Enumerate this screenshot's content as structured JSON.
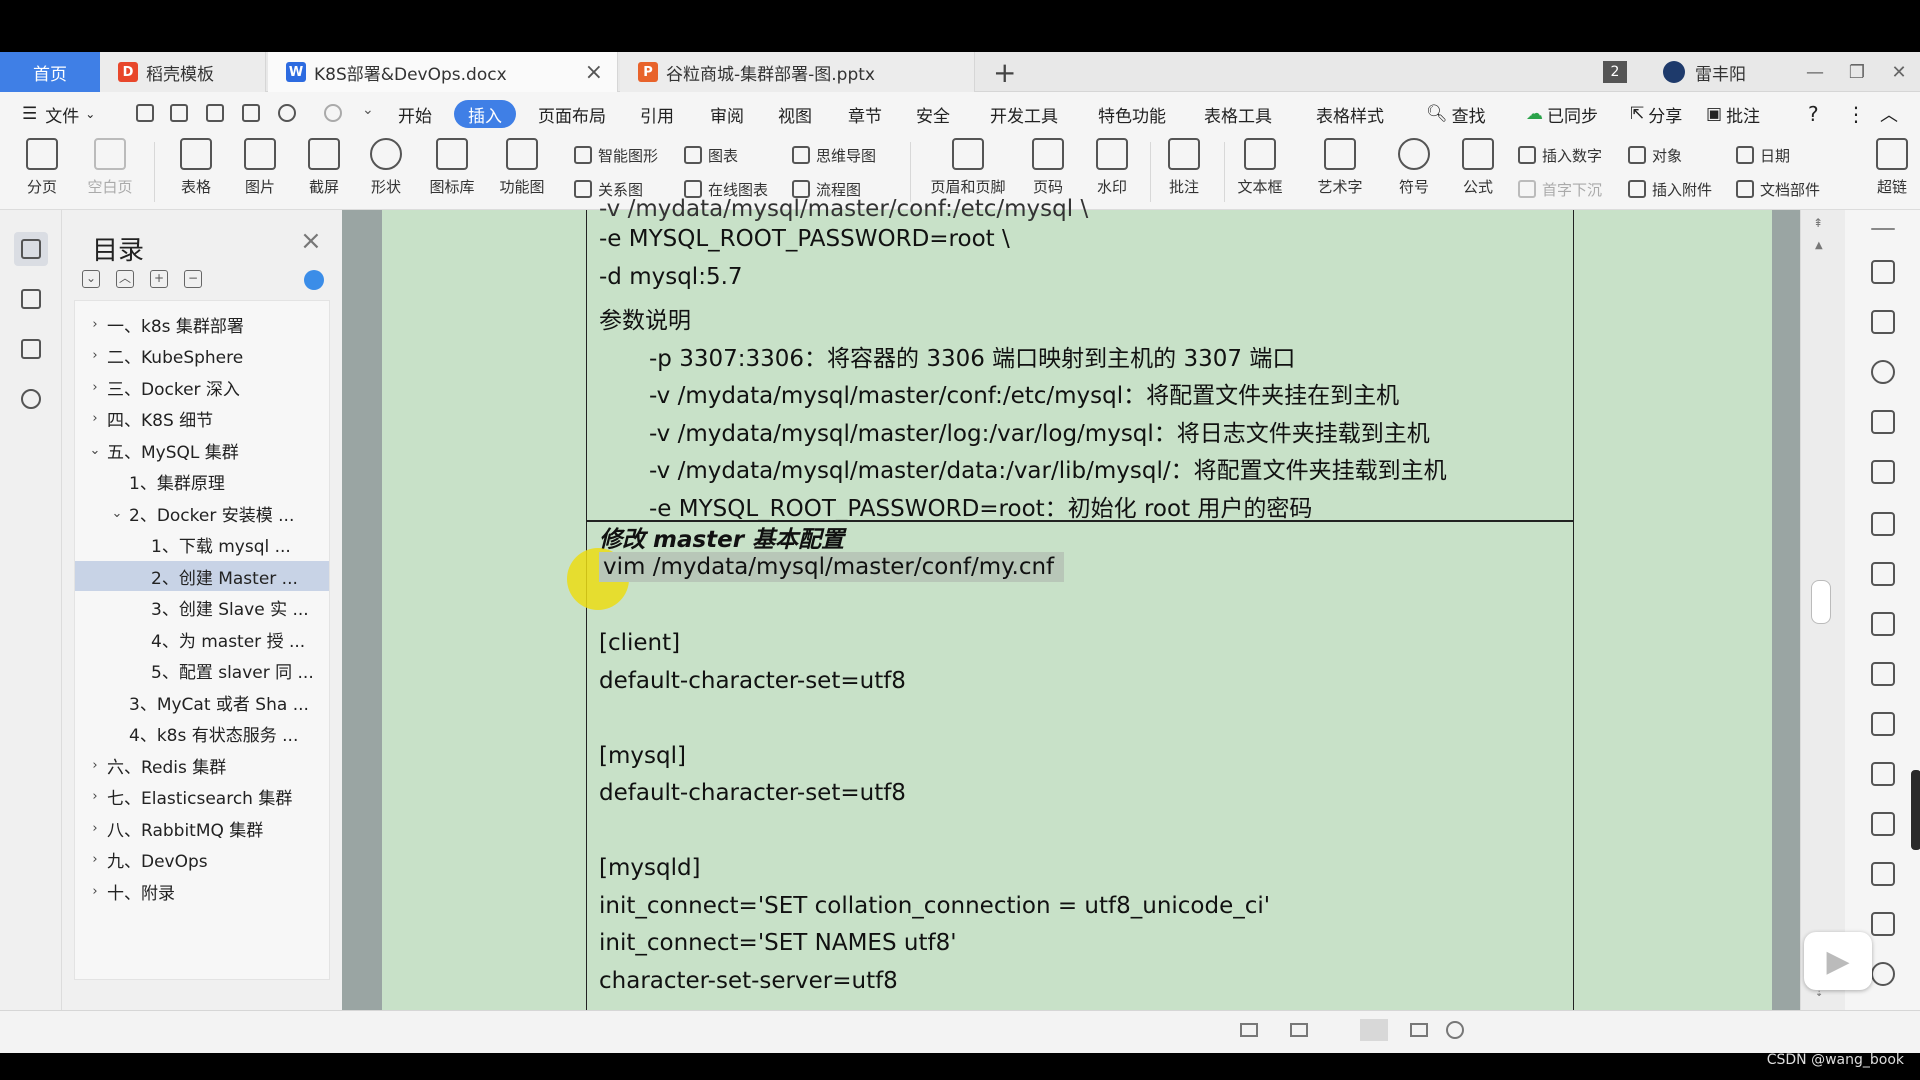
{
  "tabs": {
    "home": "首页",
    "items": [
      {
        "label": "稻壳模板",
        "icon": "daoke-icon",
        "color": "#e8472b",
        "letter": "D"
      },
      {
        "label": "K8S部署&DevOps.docx",
        "icon": "word-doc-icon",
        "color": "#2d6be0",
        "letter": "W"
      },
      {
        "label": "谷粒商城-集群部署-图.pptx",
        "icon": "ppt-doc-icon",
        "color": "#e8632b",
        "letter": "P"
      }
    ],
    "add": "+",
    "window_count": "2",
    "user": "雷丰阳"
  },
  "menu": {
    "file": "文件",
    "items": [
      "开始",
      "插入",
      "页面布局",
      "引用",
      "审阅",
      "视图",
      "章节",
      "安全",
      "开发工具",
      "特色功能",
      "表格工具",
      "表格样式"
    ],
    "active": "插入",
    "search": "查找",
    "sync": "已同步",
    "share": "分享",
    "comment": "批注",
    "help": "?"
  },
  "ribbon": {
    "big": [
      "分页",
      "空白页",
      "表格",
      "图片",
      "截屏",
      "形状",
      "图标库",
      "功能图",
      "页眉和页脚",
      "页码",
      "水印",
      "批注",
      "文本框",
      "艺术字",
      "符号",
      "公式"
    ],
    "small": [
      "智能图形",
      "图表",
      "关系图",
      "在线图表",
      "思维导图",
      "流程图",
      "插入数字",
      "对象",
      "日期",
      "首字下沉",
      "插入附件",
      "文档部件",
      "超链"
    ]
  },
  "toc": {
    "title": "目录",
    "items": [
      {
        "label": "一、k8s 集群部署",
        "level": 0,
        "arrow": "›"
      },
      {
        "label": "二、KubeSphere",
        "level": 0,
        "arrow": "›"
      },
      {
        "label": "三、Docker 深入",
        "level": 0,
        "arrow": "›"
      },
      {
        "label": "四、K8S 细节",
        "level": 0,
        "arrow": "›"
      },
      {
        "label": "五、MySQL 集群",
        "level": 0,
        "arrow": "⌄"
      },
      {
        "label": "1、集群原理",
        "level": 1,
        "arrow": ""
      },
      {
        "label": "2、Docker 安装模 ...",
        "level": 1,
        "arrow": "⌄"
      },
      {
        "label": "1、下载 mysql ...",
        "level": 2,
        "arrow": ""
      },
      {
        "label": "2、创建 Master ...",
        "level": 2,
        "arrow": "",
        "selected": true
      },
      {
        "label": "3、创建 Slave 实 ...",
        "level": 2,
        "arrow": ""
      },
      {
        "label": "4、为 master 授 ...",
        "level": 2,
        "arrow": ""
      },
      {
        "label": "5、配置 slaver 同 ...",
        "level": 2,
        "arrow": ""
      },
      {
        "label": "3、MyCat 或者 Sha ...",
        "level": 1,
        "arrow": ""
      },
      {
        "label": "4、k8s 有状态服务 ...",
        "level": 1,
        "arrow": ""
      },
      {
        "label": "六、Redis 集群",
        "level": 0,
        "arrow": "›"
      },
      {
        "label": "七、Elasticsearch 集群",
        "level": 0,
        "arrow": "›"
      },
      {
        "label": "八、RabbitMQ 集群",
        "level": 0,
        "arrow": "›"
      },
      {
        "label": "九、DevOps",
        "level": 0,
        "arrow": "›"
      },
      {
        "label": "十、附录",
        "level": 0,
        "arrow": "›"
      }
    ]
  },
  "document": {
    "top_lines": [
      {
        "text": "-e MYSQL_ROOT_PASSWORD=root \\",
        "style": "plain"
      },
      {
        "text": "-d mysql:5.7",
        "style": "plain"
      },
      {
        "text": "参数说明",
        "style": "plain"
      },
      {
        "text": "-p 3307:3306：将容器的 3306 端口映射到主机的 3307 端口",
        "style": "indent"
      },
      {
        "text": "-v /mydata/mysql/master/conf:/etc/mysql：将配置文件夹挂在到主机",
        "style": "indent"
      },
      {
        "text": "-v /mydata/mysql/master/log:/var/log/mysql：将日志文件夹挂载到主机",
        "style": "indent"
      },
      {
        "text": "-v /mydata/mysql/master/data:/var/lib/mysql/：将配置文件夹挂载到主机",
        "style": "indent"
      },
      {
        "text": "-e MYSQL_ROOT_PASSWORD=root：初始化 root 用户的密码",
        "style": "indent"
      }
    ],
    "heading": "修改 master 基本配置",
    "command": "vim /mydata/mysql/master/conf/my.cnf",
    "config_lines": [
      "[client]",
      "default-character-set=utf8",
      "",
      "[mysql]",
      "default-character-set=utf8",
      "",
      "[mysqld]",
      "init_connect='SET collation_connection = utf8_unicode_ci'",
      "init_connect='SET NAMES utf8'",
      "character-set-server=utf8"
    ]
  },
  "watermark": "CSDN @wang_book",
  "colors": {
    "accent": "#3f7fe6",
    "page": "#c8e1c8",
    "highlight": "#ebdc14"
  }
}
